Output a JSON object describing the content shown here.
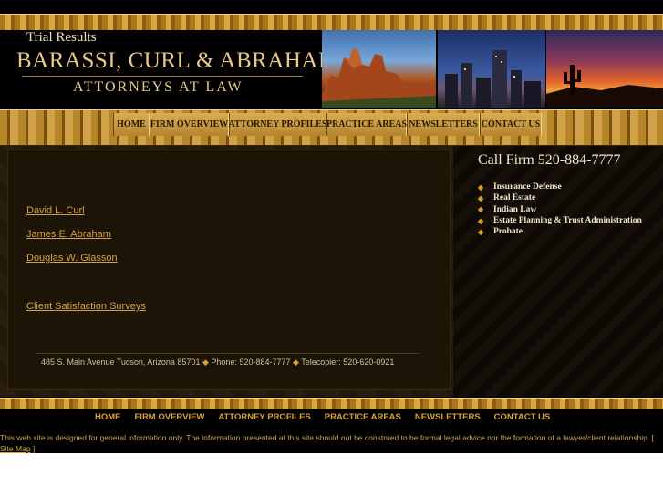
{
  "header": {
    "firm_name": "BARASSI, CURL & ABRAHAM, P.L.C.",
    "tagline": "ATTORNEYS AT LAW"
  },
  "nav": [
    "HOME",
    "FIRM OVERVIEW",
    "ATTORNEY PROFILES",
    "PRACTICE AREAS",
    "NEWSLETTERS",
    "CONTACT US"
  ],
  "main": {
    "title": "Trial Results",
    "links": [
      "David L. Curl",
      "James E. Abraham",
      "Douglas W. Glasson"
    ],
    "survey_link": "Client Satisfaction Surveys",
    "address": {
      "street": "485 S. Main Avenue Tucson, Arizona 85701",
      "phone": "Phone: 520-884-7777",
      "fax": "Telecopier: 520-620-0921",
      "separator": "◆"
    }
  },
  "sidebar": {
    "call": "Call Firm 520-884-7777",
    "bullet": "◆",
    "practice_areas": [
      "Insurance Defense",
      "Real Estate",
      "Indian Law",
      "Estate Planning & Trust Administration",
      "Probate"
    ]
  },
  "footer": {
    "nav": [
      "HOME",
      "FIRM OVERVIEW",
      "ATTORNEY PROFILES",
      "PRACTICE AREAS",
      "NEWSLETTERS",
      "CONTACT US"
    ],
    "disclaimer": "This web site is designed for general information only. The information presented at this site should not be construed to be formal legal advice nor the formation of a lawyer/client relationship. [",
    "sitemap": "Site Map",
    "sitemap_close": " ]"
  },
  "colors": {
    "gold": "#d7a23a",
    "cream": "#e9c98a",
    "background": "#000000"
  }
}
